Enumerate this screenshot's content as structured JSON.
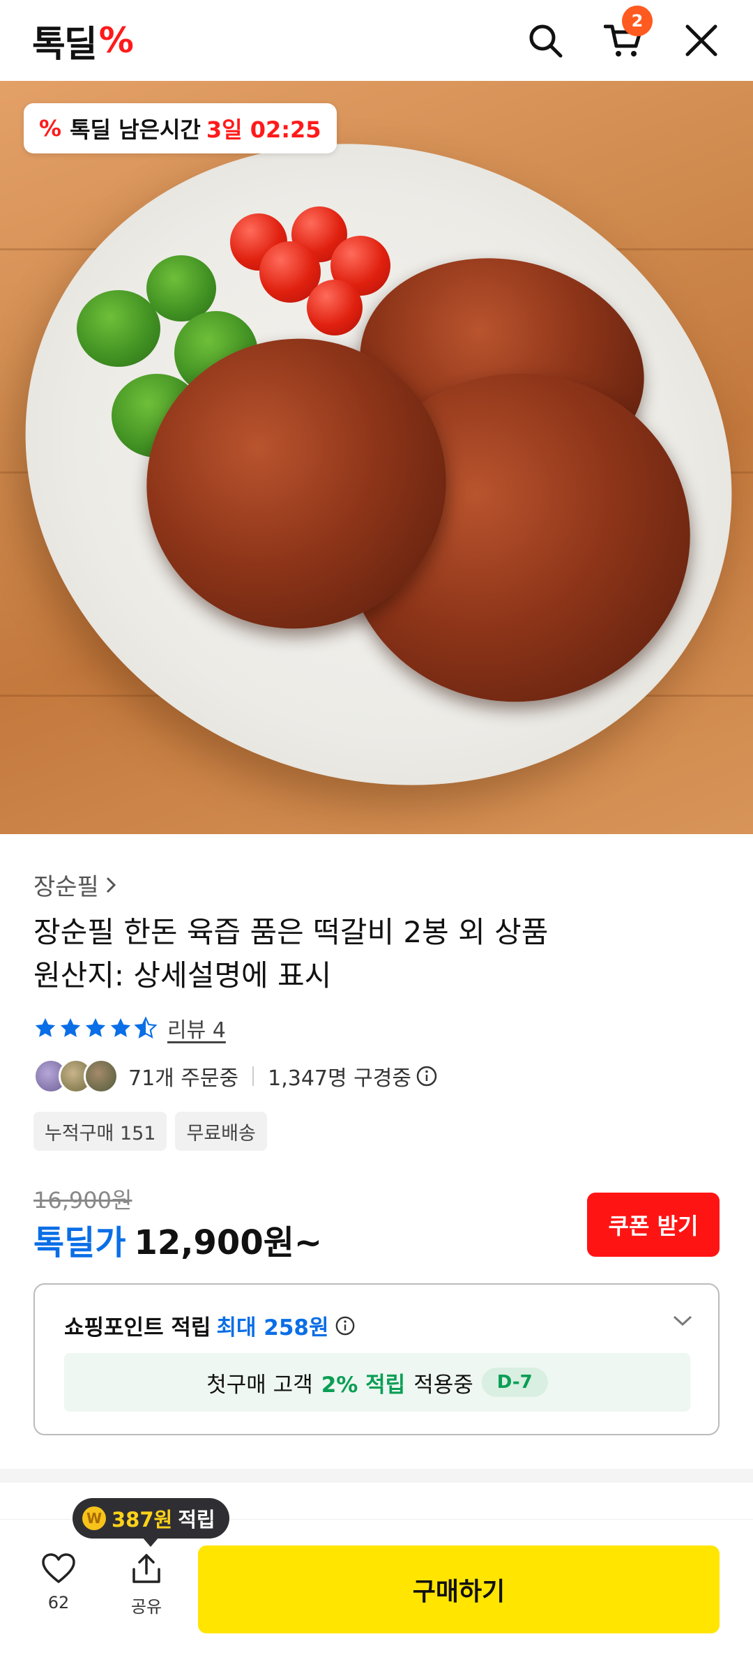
{
  "header": {
    "logo_text": "톡딜",
    "logo_pct": "%",
    "cart_count": "2"
  },
  "hero": {
    "timer_label": "톡딜 남은시간",
    "timer_value": "3일 02:25"
  },
  "product": {
    "brand": "장순필",
    "title_line1": "장순필 한돈 육즙 품은 떡갈비 2봉 외 상품",
    "title_line2": "원산지: 상세설명에 표시",
    "rating": 4.5,
    "review_label": "리뷰 4",
    "orders": "71개 주문중",
    "viewers": "1,347명 구경중",
    "tags": [
      "누적구매 151",
      "무료배송"
    ],
    "original_price": "16,900원",
    "deal_label": "톡딜가",
    "deal_price": "12,900원~",
    "coupon_label": "쿠폰 받기"
  },
  "points": {
    "head_label": "쇼핑포인트 적립",
    "head_max": "최대 258원",
    "first_buy_prefix": "첫구매 고객",
    "first_buy_rate": "2% 적립",
    "first_buy_suffix": "적용중",
    "d_badge": "D-7"
  },
  "bottom": {
    "tooltip_amount": "387원",
    "tooltip_suffix": "적립",
    "coin_symbol": "W",
    "like_count": "62",
    "share_label": "공유",
    "buy_label": "구매하기"
  },
  "colors": {
    "deal_blue": "#0a6ee6",
    "coupon_red": "#ff1414",
    "buy_yellow": "#ffe500",
    "point_green": "#0a9e55",
    "badge_orange": "#ff5a1f"
  }
}
